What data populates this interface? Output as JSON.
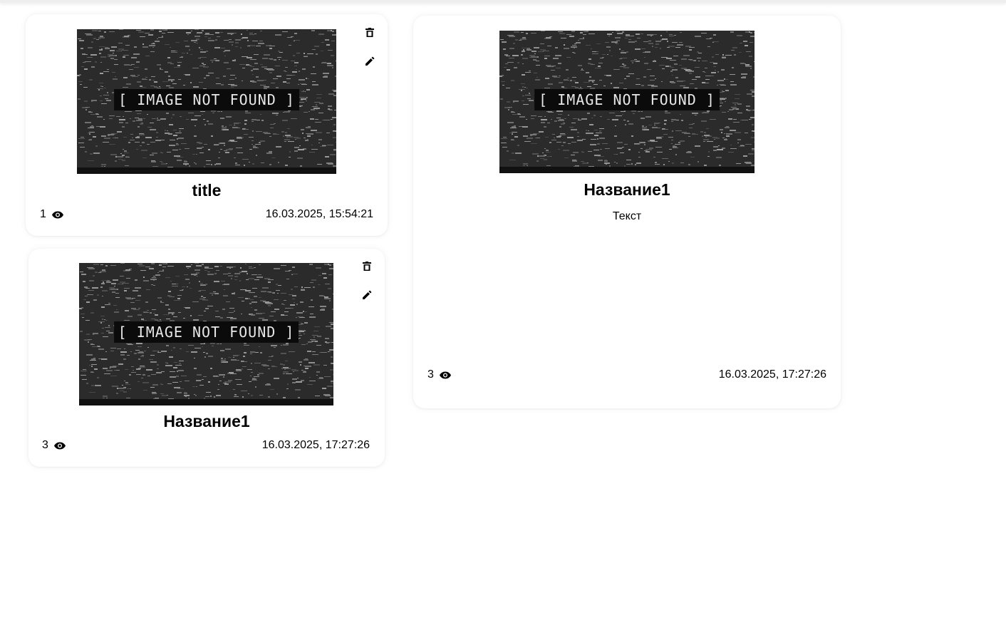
{
  "cards": [
    {
      "image_text": "[ IMAGE NOT FOUND ]",
      "title": "title",
      "views": "1",
      "date": "16.03.2025, 15:54:21",
      "actions": {
        "delete_icon": "trash-icon",
        "edit_icon": "pencil-icon"
      }
    },
    {
      "image_text": "[ IMAGE NOT FOUND ]",
      "title": "Название1",
      "views": "3",
      "date": "16.03.2025, 17:27:26",
      "actions": {
        "delete_icon": "trash-icon",
        "edit_icon": "pencil-icon"
      }
    },
    {
      "image_text": "[ IMAGE NOT FOUND ]",
      "title": "Название1",
      "text": "Текст",
      "views": "3",
      "date": "16.03.2025, 17:27:26"
    }
  ],
  "colors": {
    "text": "#000000",
    "card_bg": "#ffffff",
    "image_bg": "#2a2a2a"
  }
}
